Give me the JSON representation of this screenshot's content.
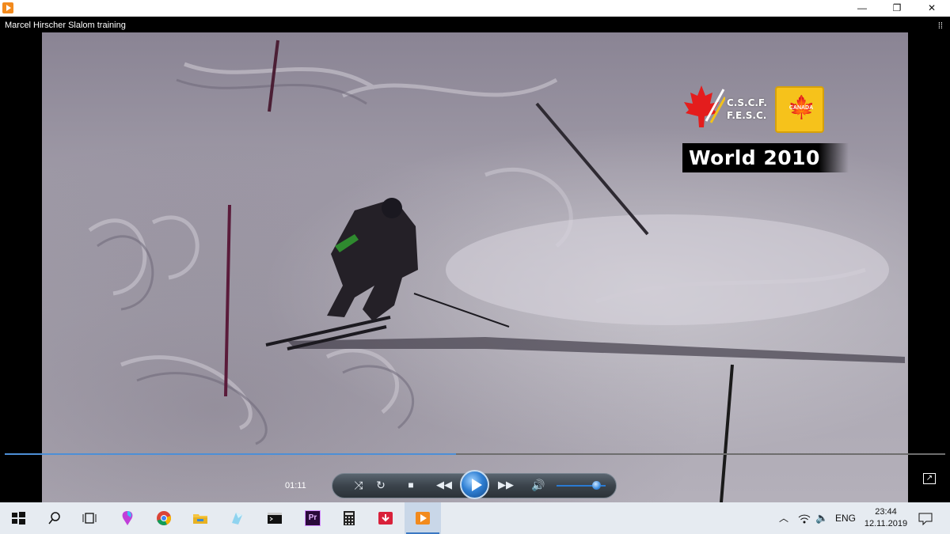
{
  "window": {
    "title": "Marcel Hirscher Slalom training",
    "minimize_glyph": "—",
    "maximize_glyph": "❐",
    "close_glyph": "✕",
    "app_icon": "media-player-icon"
  },
  "overlay": {
    "org_line1": "C.S.C.F.",
    "org_line2": "F.E.S.C.",
    "badge_text": "CANADA",
    "banner": "World 2010"
  },
  "player": {
    "elapsed": "01:11",
    "progress": 0.48,
    "volume": 0.8,
    "controls": {
      "shuffle_icon": "shuffle-icon",
      "repeat_icon": "repeat-icon",
      "stop_icon": "stop-icon",
      "previous_icon": "previous-icon",
      "play_icon": "play-icon",
      "next_icon": "next-icon",
      "volume_icon": "volume-icon",
      "fullscreen_icon": "fullscreen-icon"
    }
  },
  "taskbar": {
    "items": [
      {
        "name": "start-button",
        "icon": "windows-icon"
      },
      {
        "name": "search-button",
        "icon": "search-icon"
      },
      {
        "name": "task-view-button",
        "icon": "task-view-icon"
      },
      {
        "name": "paint-3d-app",
        "icon": "paint-3d-icon"
      },
      {
        "name": "chrome-app",
        "icon": "chrome-icon"
      },
      {
        "name": "file-explorer-app",
        "icon": "folder-icon"
      },
      {
        "name": "app-crystal",
        "icon": "crystal-icon"
      },
      {
        "name": "terminal-app",
        "icon": "terminal-icon"
      },
      {
        "name": "premiere-app",
        "icon": "premiere-icon",
        "label": "Pr"
      },
      {
        "name": "calculator-app",
        "icon": "calculator-icon"
      },
      {
        "name": "download-app",
        "icon": "download-icon"
      },
      {
        "name": "media-player-app",
        "icon": "media-player-icon",
        "active": true
      }
    ],
    "language": "ENG",
    "time": "23:44",
    "date": "12.11.2019"
  }
}
